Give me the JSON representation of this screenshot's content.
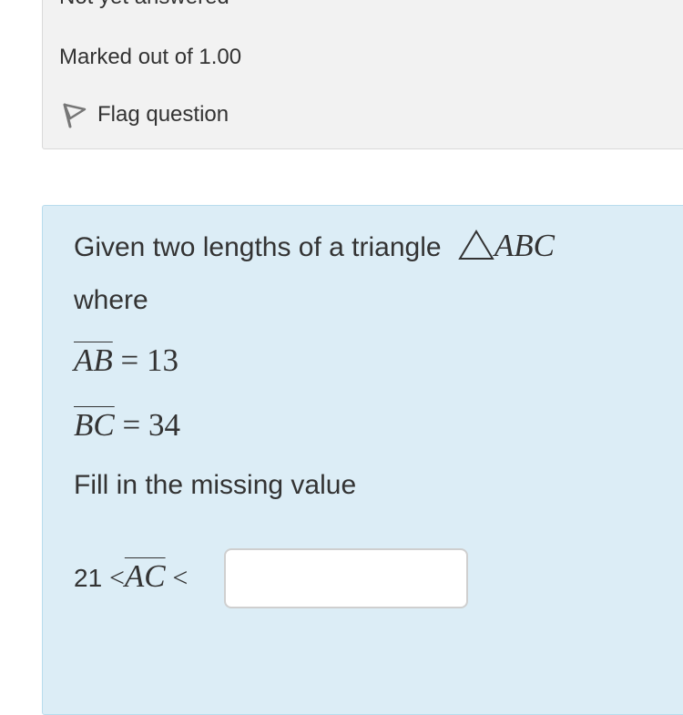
{
  "info": {
    "state": "Not yet answered",
    "mark": "Marked out of 1.00",
    "flag_label": "Flag question"
  },
  "question": {
    "line1_text": "Given two lengths of a triangle",
    "triangle_name": "ABC",
    "line2_text": "where",
    "given1": {
      "segment": "AB",
      "relation": "=",
      "value": "13"
    },
    "given2": {
      "segment": "BC",
      "relation": "=",
      "value": "34"
    },
    "instruction": "Fill in the missing value",
    "answer": {
      "lower_bound": "21",
      "less_than": "<",
      "segment": "AC",
      "input_value": ""
    }
  },
  "icons": {
    "flag": "flag-icon",
    "triangle": "triangle-symbol"
  },
  "colors": {
    "info_bg": "#f2f2f2",
    "question_bg": "#dcedf6",
    "question_border": "#b8dced"
  }
}
